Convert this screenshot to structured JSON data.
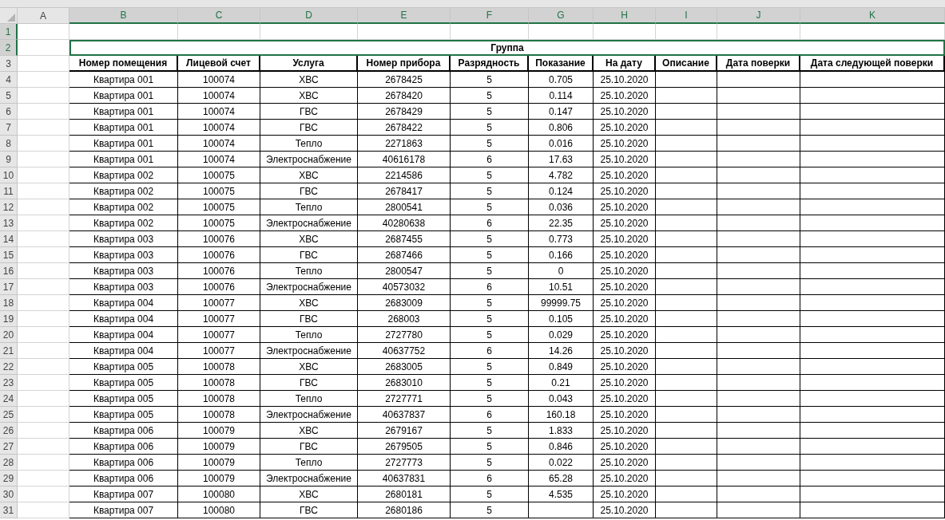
{
  "columns": [
    {
      "letter": "A",
      "selected": false
    },
    {
      "letter": "B",
      "selected": true
    },
    {
      "letter": "C",
      "selected": true
    },
    {
      "letter": "D",
      "selected": true
    },
    {
      "letter": "E",
      "selected": true
    },
    {
      "letter": "F",
      "selected": true
    },
    {
      "letter": "G",
      "selected": true
    },
    {
      "letter": "H",
      "selected": true
    },
    {
      "letter": "I",
      "selected": true
    },
    {
      "letter": "J",
      "selected": true
    },
    {
      "letter": "K",
      "selected": true
    }
  ],
  "row_numbers": [
    {
      "label": "1",
      "selected": true
    },
    {
      "label": "2",
      "selected": true
    },
    {
      "label": "3",
      "selected": false
    },
    {
      "label": "4",
      "selected": false
    },
    {
      "label": "5",
      "selected": false
    },
    {
      "label": "6",
      "selected": false
    },
    {
      "label": "7",
      "selected": false
    },
    {
      "label": "8",
      "selected": false
    },
    {
      "label": "9",
      "selected": false
    },
    {
      "label": "10",
      "selected": false
    },
    {
      "label": "11",
      "selected": false
    },
    {
      "label": "12",
      "selected": false
    },
    {
      "label": "13",
      "selected": false
    },
    {
      "label": "14",
      "selected": false
    },
    {
      "label": "15",
      "selected": false
    },
    {
      "label": "16",
      "selected": false
    },
    {
      "label": "17",
      "selected": false
    },
    {
      "label": "18",
      "selected": false
    },
    {
      "label": "19",
      "selected": false
    },
    {
      "label": "20",
      "selected": false
    },
    {
      "label": "21",
      "selected": false
    },
    {
      "label": "22",
      "selected": false
    },
    {
      "label": "23",
      "selected": false
    },
    {
      "label": "24",
      "selected": false
    },
    {
      "label": "25",
      "selected": false
    },
    {
      "label": "26",
      "selected": false
    },
    {
      "label": "27",
      "selected": false
    },
    {
      "label": "28",
      "selected": false
    },
    {
      "label": "29",
      "selected": false
    },
    {
      "label": "30",
      "selected": false
    },
    {
      "label": "31",
      "selected": false
    }
  ],
  "group_title": "Группа",
  "headers": [
    "Номер помещения",
    "Лицевой счет",
    "Услуга",
    "Номер прибора",
    "Разрядность",
    "Показание",
    "На дату",
    "Описание",
    "Дата поверки",
    "Дата следующей поверки"
  ],
  "rows": [
    {
      "room": "Квартира 001",
      "account": "100074",
      "service": "ХВС",
      "meter": "2678425",
      "digits": "5",
      "reading": "0.705",
      "date": "25.10.2020"
    },
    {
      "room": "Квартира 001",
      "account": "100074",
      "service": "ХВС",
      "meter": "2678420",
      "digits": "5",
      "reading": "0.114",
      "date": "25.10.2020"
    },
    {
      "room": "Квартира 001",
      "account": "100074",
      "service": "ГВС",
      "meter": "2678429",
      "digits": "5",
      "reading": "0.147",
      "date": "25.10.2020"
    },
    {
      "room": "Квартира 001",
      "account": "100074",
      "service": "ГВС",
      "meter": "2678422",
      "digits": "5",
      "reading": "0.806",
      "date": "25.10.2020"
    },
    {
      "room": "Квартира 001",
      "account": "100074",
      "service": "Тепло",
      "meter": "2271863",
      "digits": "5",
      "reading": "0.016",
      "date": "25.10.2020"
    },
    {
      "room": "Квартира 001",
      "account": "100074",
      "service": "Электроснабжение",
      "meter": "40616178",
      "digits": "6",
      "reading": "17.63",
      "date": "25.10.2020"
    },
    {
      "room": "Квартира 002",
      "account": "100075",
      "service": "ХВС",
      "meter": "2214586",
      "digits": "5",
      "reading": "4.782",
      "date": "25.10.2020"
    },
    {
      "room": "Квартира 002",
      "account": "100075",
      "service": "ГВС",
      "meter": "2678417",
      "digits": "5",
      "reading": "0.124",
      "date": "25.10.2020"
    },
    {
      "room": "Квартира 002",
      "account": "100075",
      "service": "Тепло",
      "meter": "2800541",
      "digits": "5",
      "reading": "0.036",
      "date": "25.10.2020"
    },
    {
      "room": "Квартира 002",
      "account": "100075",
      "service": "Электроснабжение",
      "meter": "40280638",
      "digits": "6",
      "reading": "22.35",
      "date": "25.10.2020"
    },
    {
      "room": "Квартира 003",
      "account": "100076",
      "service": "ХВС",
      "meter": "2687455",
      "digits": "5",
      "reading": "0.773",
      "date": "25.10.2020"
    },
    {
      "room": "Квартира 003",
      "account": "100076",
      "service": "ГВС",
      "meter": "2687466",
      "digits": "5",
      "reading": "0.166",
      "date": "25.10.2020"
    },
    {
      "room": "Квартира 003",
      "account": "100076",
      "service": "Тепло",
      "meter": "2800547",
      "digits": "5",
      "reading": "0",
      "date": "25.10.2020"
    },
    {
      "room": "Квартира 003",
      "account": "100076",
      "service": "Электроснабжение",
      "meter": "40573032",
      "digits": "6",
      "reading": "10.51",
      "date": "25.10.2020"
    },
    {
      "room": "Квартира 004",
      "account": "100077",
      "service": "ХВС",
      "meter": "2683009",
      "digits": "5",
      "reading": "99999.75",
      "date": "25.10.2020"
    },
    {
      "room": "Квартира 004",
      "account": "100077",
      "service": "ГВС",
      "meter": "268003",
      "digits": "5",
      "reading": "0.105",
      "date": "25.10.2020"
    },
    {
      "room": "Квартира 004",
      "account": "100077",
      "service": "Тепло",
      "meter": "2727780",
      "digits": "5",
      "reading": "0.029",
      "date": "25.10.2020"
    },
    {
      "room": "Квартира 004",
      "account": "100077",
      "service": "Электроснабжение",
      "meter": "40637752",
      "digits": "6",
      "reading": "14.26",
      "date": "25.10.2020"
    },
    {
      "room": "Квартира 005",
      "account": "100078",
      "service": "ХВС",
      "meter": "2683005",
      "digits": "5",
      "reading": "0.849",
      "date": "25.10.2020"
    },
    {
      "room": "Квартира 005",
      "account": "100078",
      "service": "ГВС",
      "meter": "2683010",
      "digits": "5",
      "reading": "0.21",
      "date": "25.10.2020"
    },
    {
      "room": "Квартира 005",
      "account": "100078",
      "service": "Тепло",
      "meter": "2727771",
      "digits": "5",
      "reading": "0.043",
      "date": "25.10.2020"
    },
    {
      "room": "Квартира 005",
      "account": "100078",
      "service": "Электроснабжение",
      "meter": "40637837",
      "digits": "6",
      "reading": "160.18",
      "date": "25.10.2020"
    },
    {
      "room": "Квартира 006",
      "account": "100079",
      "service": "ХВС",
      "meter": "2679167",
      "digits": "5",
      "reading": "1.833",
      "date": "25.10.2020"
    },
    {
      "room": "Квартира 006",
      "account": "100079",
      "service": "ГВС",
      "meter": "2679505",
      "digits": "5",
      "reading": "0.846",
      "date": "25.10.2020"
    },
    {
      "room": "Квартира 006",
      "account": "100079",
      "service": "Тепло",
      "meter": "2727773",
      "digits": "5",
      "reading": "0.022",
      "date": "25.10.2020"
    },
    {
      "room": "Квартира 006",
      "account": "100079",
      "service": "Электроснабжение",
      "meter": "40637831",
      "digits": "6",
      "reading": "65.28",
      "date": "25.10.2020"
    },
    {
      "room": "Квартира 007",
      "account": "100080",
      "service": "ХВС",
      "meter": "2680181",
      "digits": "5",
      "reading": "4.535",
      "date": "25.10.2020"
    },
    {
      "room": "Квартира 007",
      "account": "100080",
      "service": "ГВС",
      "meter": "2680186",
      "digits": "5",
      "date": "25.10.2020"
    }
  ]
}
